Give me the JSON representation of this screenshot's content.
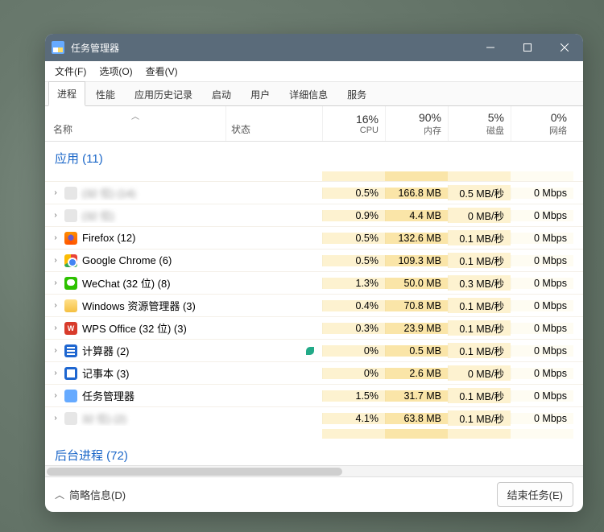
{
  "window": {
    "title": "任务管理器"
  },
  "menu": {
    "file": "文件(F)",
    "options": "选项(O)",
    "view": "查看(V)"
  },
  "tabs": {
    "processes": "进程",
    "performance": "性能",
    "app_history": "应用历史记录",
    "startup": "启动",
    "users": "用户",
    "details": "详细信息",
    "services": "服务"
  },
  "columns": {
    "name": "名称",
    "status": "状态",
    "cpu_pct": "16%",
    "cpu_label": "CPU",
    "mem_pct": "90%",
    "mem_label": "内存",
    "disk_pct": "5%",
    "disk_label": "磁盘",
    "net_pct": "0%",
    "net_label": "网络"
  },
  "groups": {
    "apps": "应用 (11)",
    "background": "后台进程 (72)"
  },
  "rows": [
    {
      "name": "(32 位) (14)",
      "blur": true,
      "icon": "blank",
      "cpu": "0.5%",
      "mem": "166.8 MB",
      "disk": "0.5 MB/秒",
      "net": "0 Mbps",
      "status": ""
    },
    {
      "name": "(32 位)",
      "blur": true,
      "icon": "blank",
      "cpu": "0.9%",
      "mem": "4.4 MB",
      "disk": "0 MB/秒",
      "net": "0 Mbps",
      "status": ""
    },
    {
      "name": "Firefox (12)",
      "icon": "firefox",
      "cpu": "0.5%",
      "mem": "132.6 MB",
      "disk": "0.1 MB/秒",
      "net": "0 Mbps",
      "status": ""
    },
    {
      "name": "Google Chrome (6)",
      "icon": "chrome",
      "cpu": "0.5%",
      "mem": "109.3 MB",
      "disk": "0.1 MB/秒",
      "net": "0 Mbps",
      "status": ""
    },
    {
      "name": "WeChat (32 位) (8)",
      "icon": "wechat",
      "cpu": "1.3%",
      "mem": "50.0 MB",
      "disk": "0.3 MB/秒",
      "net": "0 Mbps",
      "status": ""
    },
    {
      "name": "Windows 资源管理器 (3)",
      "icon": "folder",
      "cpu": "0.4%",
      "mem": "70.8 MB",
      "disk": "0.1 MB/秒",
      "net": "0 Mbps",
      "status": ""
    },
    {
      "name": "WPS Office (32 位) (3)",
      "icon": "wps",
      "cpu": "0.3%",
      "mem": "23.9 MB",
      "disk": "0.1 MB/秒",
      "net": "0 Mbps",
      "status": ""
    },
    {
      "name": "计算器 (2)",
      "icon": "calc",
      "cpu": "0%",
      "mem": "0.5 MB",
      "disk": "0.1 MB/秒",
      "net": "0 Mbps",
      "status": "leaf"
    },
    {
      "name": "记事本 (3)",
      "icon": "notepad",
      "cpu": "0%",
      "mem": "2.6 MB",
      "disk": "0 MB/秒",
      "net": "0 Mbps",
      "status": ""
    },
    {
      "name": "任务管理器",
      "icon": "tm",
      "cpu": "1.5%",
      "mem": "31.7 MB",
      "disk": "0.1 MB/秒",
      "net": "0 Mbps",
      "status": ""
    },
    {
      "name": "32 位) (2)",
      "blur": true,
      "icon": "blank",
      "cpu": "4.1%",
      "mem": "63.8 MB",
      "disk": "0.1 MB/秒",
      "net": "0 Mbps",
      "status": ""
    }
  ],
  "footer": {
    "fewer_details": "简略信息(D)",
    "end_task": "结束任务(E)"
  }
}
